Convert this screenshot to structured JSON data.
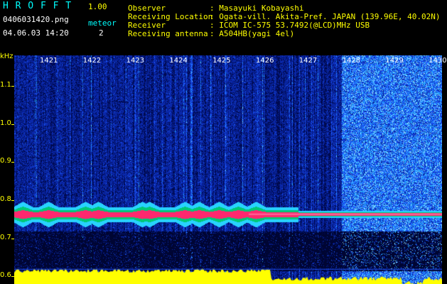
{
  "app": {
    "title": "H R O F F T",
    "version": "1.00"
  },
  "file": {
    "name": "0406031420.png",
    "datetime": "04.06.03 14:20"
  },
  "meteor": {
    "label": "meteor",
    "count": "2"
  },
  "info": [
    {
      "label": "Observer",
      "value": ": Masayuki Kobayashi"
    },
    {
      "label": "Receiving Location",
      "value": ": Ogata-vill. Akita-Pref. JAPAN (139.96E, 40.02N)"
    },
    {
      "label": "Receiver",
      "value": ": ICOM IC-575 53.7492(@LCD)MHz USB"
    },
    {
      "label": "Receiving antenna",
      "value": ": A504HB(yagi 4el)"
    }
  ],
  "y_axis": {
    "unit": "kHz",
    "ticks": [
      {
        "label": "1.1",
        "value": 1.1
      },
      {
        "label": "1.0",
        "value": 1.0
      },
      {
        "label": "0.9",
        "value": 0.9
      },
      {
        "label": "0.8",
        "value": 0.8
      },
      {
        "label": "0.7",
        "value": 0.7
      },
      {
        "label": "0.6",
        "value": 0.6
      }
    ],
    "range": [
      0.58,
      1.18
    ]
  },
  "time_axis": {
    "labels": [
      "1421",
      "1422",
      "1423",
      "1424",
      "1425",
      "1426",
      "1427",
      "1428",
      "1429",
      "1430"
    ]
  },
  "colors": {
    "noise_dark": "#001a66",
    "noise_mid": "#1e50ff",
    "noise_bright": "#00e5ff",
    "echo_line": "#ff2d6a",
    "signal_floor": "#ffff00",
    "text_cyan": "#00ffff",
    "text_yellow": "#ffff00"
  }
}
